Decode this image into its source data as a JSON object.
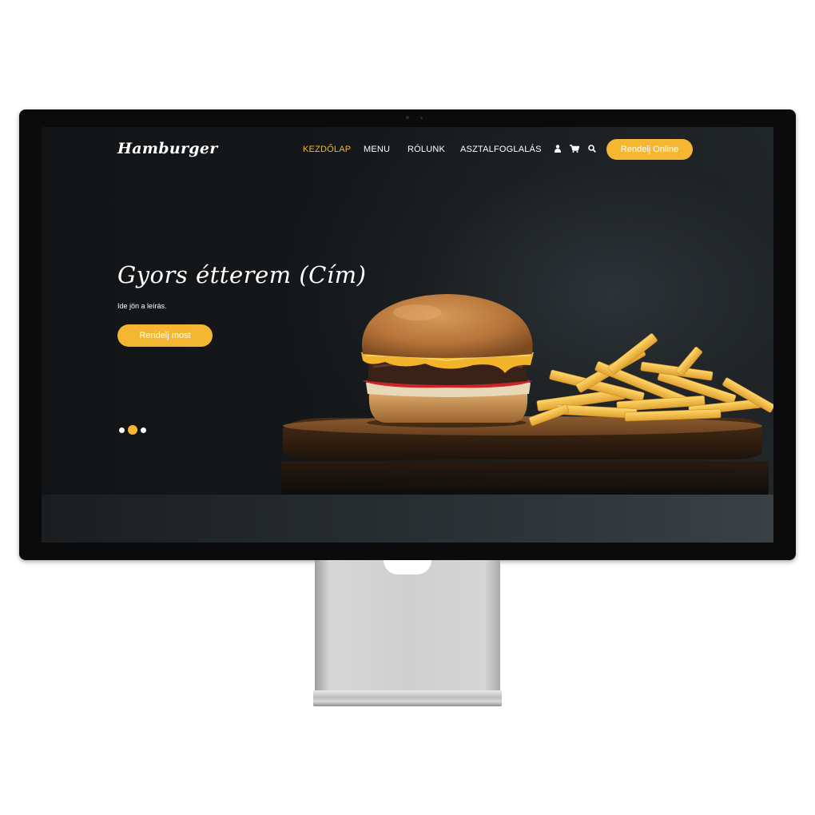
{
  "nav": {
    "logo": "Hamburger",
    "links": [
      {
        "label": "KEZDŐLAP",
        "active": true
      },
      {
        "label": "MENU",
        "active": false
      },
      {
        "label": "RÓLUNK",
        "active": false
      },
      {
        "label": "ASZTALFOGLALÁS",
        "active": false
      }
    ],
    "icons": [
      "user-icon",
      "cart-icon",
      "search-icon"
    ],
    "cta_label": "Rendelj Online"
  },
  "hero": {
    "title": "Gyors étterem (Cím)",
    "description": "Ide jön a leírás.",
    "cta_label": "Rendelj most",
    "slides_count": 3,
    "active_slide": 2
  },
  "colors": {
    "accent": "#f5b731",
    "background": "#141618",
    "text": "#ffffff"
  }
}
